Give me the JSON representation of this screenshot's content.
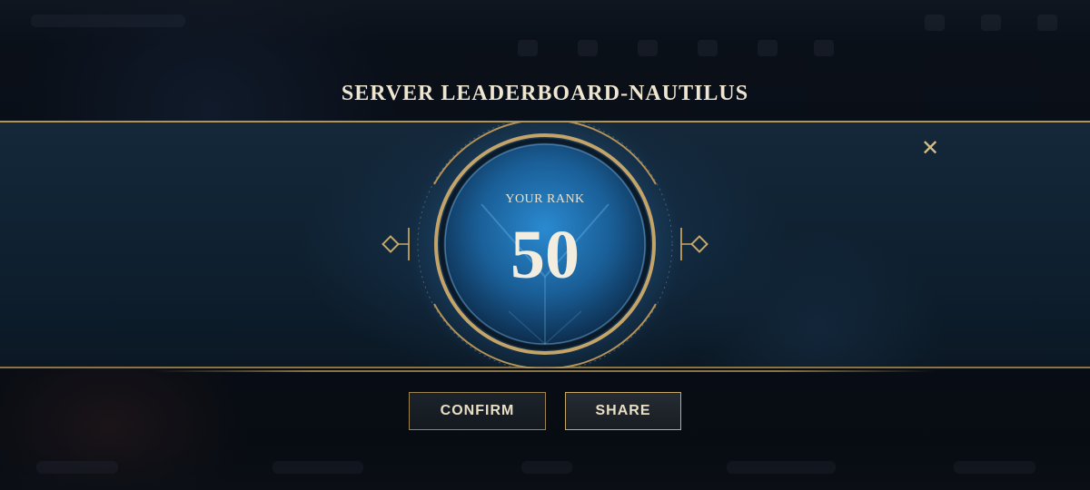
{
  "dialog": {
    "title": "SERVER LEADERBOARD-NAUTILUS",
    "rank_label": "YOUR RANK",
    "rank_value": "50",
    "close_icon": "close-icon"
  },
  "buttons": {
    "confirm_label": "CONFIRM",
    "share_label": "SHARE"
  },
  "colors": {
    "gold_accent": "#b29358",
    "text_cream": "#efe6d2",
    "orb_blue": "#1a6aa8",
    "banner_bg": "#14283a"
  }
}
